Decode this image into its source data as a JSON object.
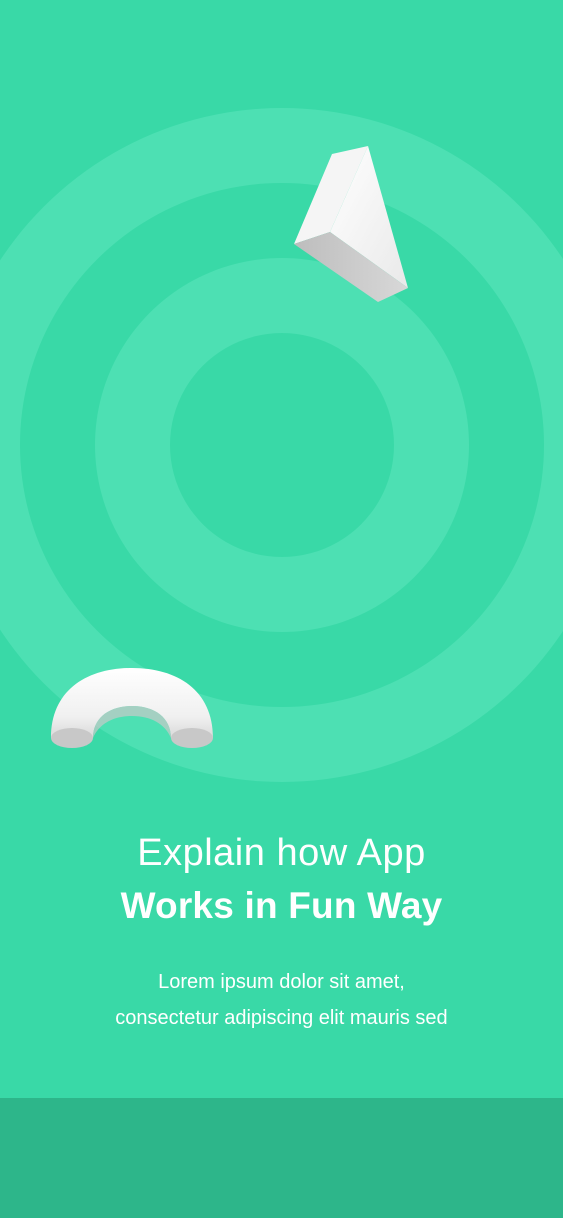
{
  "theme": {
    "background": "#39D9A7",
    "ring_color": "#4DE0B3",
    "bottom_bar_color": "#2DB68A",
    "text_color": "#FFFFFF"
  },
  "illustration": {
    "shapes": [
      "pyramid-icon",
      "torus-arch-icon"
    ]
  },
  "headline": {
    "line1": "Explain how App",
    "line2": "Works in Fun Way"
  },
  "body": {
    "line1": "Lorem ipsum dolor sit amet,",
    "line2": "consectetur adipiscing elit mauris sed"
  }
}
